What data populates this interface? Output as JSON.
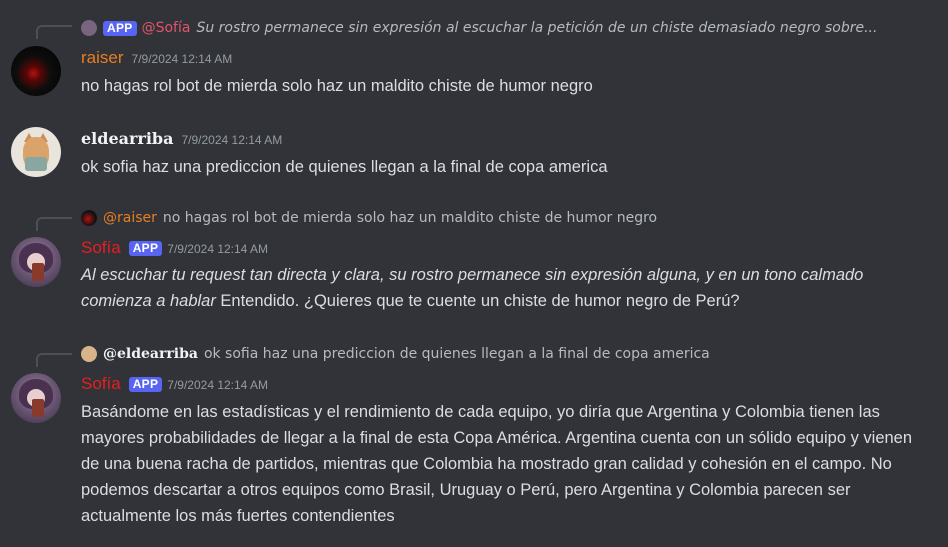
{
  "messages": [
    {
      "reply": {
        "author": "@Sofía",
        "tag": "APP",
        "text": "Su rostro permanece sin expresión al escuchar la petición de un chiste demasiado negro sobre..."
      },
      "author": "raiser",
      "timestamp": "7/9/2024 12:14 AM",
      "content": "no hagas rol bot de mierda solo haz un maldito chiste de humor negro"
    },
    {
      "author": "eldearriba",
      "timestamp": "7/9/2024 12:14 AM",
      "content": "ok sofia haz una prediccion de quienes llegan a la final de copa america"
    },
    {
      "reply": {
        "author": "@raiser",
        "text": "no hagas rol bot de mierda solo haz un maldito chiste de humor negro"
      },
      "author": "Sofía",
      "tag": "APP",
      "timestamp": "7/9/2024 12:14 AM",
      "content_italic": "Al escuchar tu request tan directa y clara, su rostro permanece sin expresión alguna, y en un tono calmado comienza a hablar",
      "content": " Entendido. ¿Quieres que te cuente un chiste de humor negro de Perú?"
    },
    {
      "reply": {
        "author": "@eldearriba",
        "text": "ok sofia haz una prediccion de quienes llegan a la final de copa america"
      },
      "author": "Sofía",
      "tag": "APP",
      "timestamp": "7/9/2024 12:14 AM",
      "content": "Basándome en las estadísticas y el rendimiento de cada equipo, yo diría que Argentina y Colombia tienen las mayores probabilidades de llegar a la final de esta Copa América. Argentina cuenta con un sólido equipo y vienen de una buena racha de partidos, mientras que Colombia ha mostrado gran calidad y cohesión en el campo. No podemos descartar a otros equipos como Brasil, Uruguay o Perú, pero Argentina y Colombia parecen ser actualmente los más fuertes contendientes"
    }
  ],
  "colors": {
    "background": "#313338",
    "raiser": "#e67e22",
    "sofia": "#e91e1e",
    "app_tag": "#5865f2"
  }
}
